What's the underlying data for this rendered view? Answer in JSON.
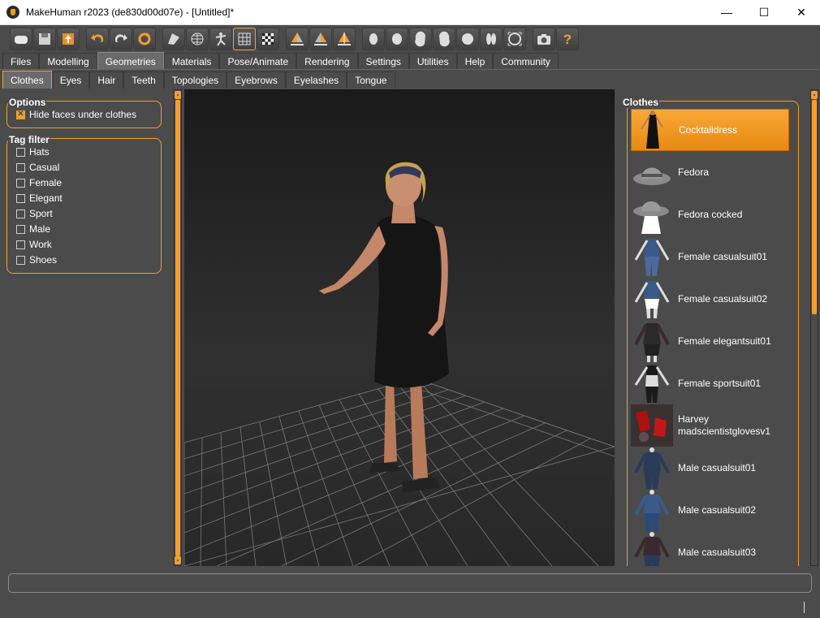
{
  "window": {
    "title": "MakeHuman r2023 (de830d00d07e) - [Untitled]*",
    "minimize": "—",
    "maximize": "☐",
    "close": "✕"
  },
  "toolbar": {
    "buttons": [
      "new-file-icon",
      "save-icon",
      "export-icon",
      "undo-icon",
      "redo-icon",
      "reset-icon",
      "smooth-icon",
      "wireframe-icon",
      "pose-icon",
      "grid-icon",
      "background-icon",
      "symmetry-right-icon",
      "symmetry-left-icon",
      "symmetry-icon",
      "front-view-icon",
      "back-view-icon",
      "left-view-icon",
      "right-view-icon",
      "top-view-icon",
      "bottom-view-icon",
      "reset-camera-icon",
      "screenshot-icon",
      "help-icon"
    ]
  },
  "main_tabs": [
    "Files",
    "Modelling",
    "Geometries",
    "Materials",
    "Pose/Animate",
    "Rendering",
    "Settings",
    "Utilities",
    "Help",
    "Community"
  ],
  "main_tab_active": "Geometries",
  "sub_tabs": [
    "Clothes",
    "Eyes",
    "Hair",
    "Teeth",
    "Topologies",
    "Eyebrows",
    "Eyelashes",
    "Tongue"
  ],
  "sub_tab_active": "Clothes",
  "options": {
    "title": "Options",
    "hide_faces": {
      "label": "Hide faces under clothes",
      "checked": true
    }
  },
  "tag_filter": {
    "title": "Tag filter",
    "tags": [
      "Hats",
      "Casual",
      "Female",
      "Elegant",
      "Sport",
      "Male",
      "Work",
      "Shoes"
    ]
  },
  "clothes": {
    "title": "Clothes",
    "items": [
      {
        "label": "Cocktaildress",
        "selected": true
      },
      {
        "label": "Fedora"
      },
      {
        "label": "Fedora cocked"
      },
      {
        "label": "Female casualsuit01"
      },
      {
        "label": "Female casualsuit02"
      },
      {
        "label": "Female elegantsuit01"
      },
      {
        "label": "Female sportsuit01"
      },
      {
        "label": "Harvey madscientistglovesv1"
      },
      {
        "label": "Male casualsuit01"
      },
      {
        "label": "Male casualsuit02"
      },
      {
        "label": "Male casualsuit03"
      }
    ]
  },
  "colors": {
    "accent": "#f0a030",
    "panel": "#4b4b4b"
  }
}
